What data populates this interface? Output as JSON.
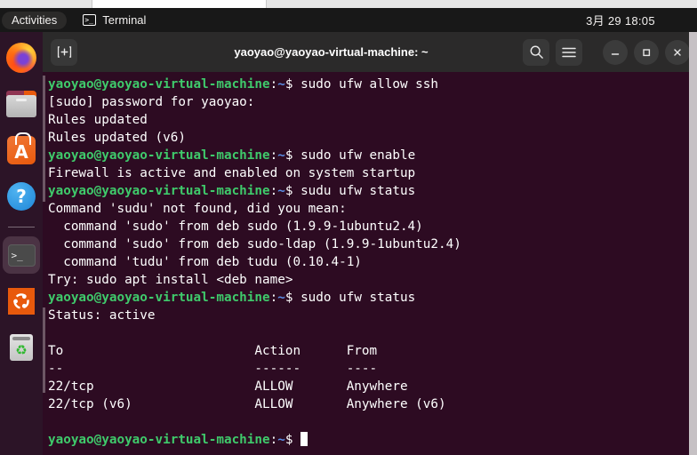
{
  "topbar": {
    "activities": "Activities",
    "app_name": "Terminal",
    "app_icon": "terminal-icon",
    "terminal_glyph": ">_",
    "clock": "3月 29  18:05"
  },
  "dock": {
    "items": [
      {
        "name": "firefox",
        "label": "Firefox",
        "running": false
      },
      {
        "name": "files",
        "label": "Files",
        "running": false
      },
      {
        "name": "app-center",
        "label": "App Center",
        "letter": "A",
        "running": false
      },
      {
        "name": "help",
        "label": "Help",
        "glyph": "?",
        "running": false
      },
      {
        "name": "terminal",
        "label": "Terminal",
        "glyph": ">_",
        "running": true
      },
      {
        "name": "ubuntu-software",
        "label": "Ubuntu Software",
        "running": false
      },
      {
        "name": "trash",
        "label": "Trash",
        "glyph": "♻",
        "running": false
      }
    ]
  },
  "window": {
    "title": "yaoyao@yaoyao-virtual-machine: ~",
    "new_tab_label": "+",
    "search_label": "Search",
    "menu_label": "Menu",
    "minimize_label": "—",
    "maximize_label": "□",
    "close_label": "✕",
    "colors": {
      "terminal_bg": "#2d0b22",
      "header_bg": "#2b2a2a",
      "prompt_user": "#3fca6b",
      "prompt_path": "#5b8fe8",
      "text": "#ffffff",
      "dock_bg": "#2c1427",
      "accent_orange": "#e8590c"
    }
  },
  "terminal": {
    "prompt": {
      "user_host": "yaoyao@yaoyao-virtual-machine",
      "separator": ":",
      "path": "~",
      "dollar": "$ "
    },
    "lines": [
      {
        "type": "prompt",
        "command": "sudo ufw allow ssh"
      },
      {
        "type": "output",
        "text": "[sudo] password for yaoyao:"
      },
      {
        "type": "output",
        "text": "Rules updated"
      },
      {
        "type": "output",
        "text": "Rules updated (v6)"
      },
      {
        "type": "prompt",
        "command": "sudo ufw enable"
      },
      {
        "type": "output",
        "text": "Firewall is active and enabled on system startup"
      },
      {
        "type": "prompt",
        "command": "sudu ufw status"
      },
      {
        "type": "output",
        "text": "Command 'sudu' not found, did you mean:"
      },
      {
        "type": "output",
        "text": "  command 'sudo' from deb sudo (1.9.9-1ubuntu2.4)"
      },
      {
        "type": "output",
        "text": "  command 'sudo' from deb sudo-ldap (1.9.9-1ubuntu2.4)"
      },
      {
        "type": "output",
        "text": "  command 'tudu' from deb tudu (0.10.4-1)"
      },
      {
        "type": "output",
        "text": "Try: sudo apt install <deb name>"
      },
      {
        "type": "prompt",
        "command": "sudo ufw status"
      },
      {
        "type": "output",
        "text": "Status: active"
      },
      {
        "type": "output",
        "text": ""
      },
      {
        "type": "output",
        "text": "To                         Action      From"
      },
      {
        "type": "output",
        "text": "--                         ------      ----"
      },
      {
        "type": "output",
        "text": "22/tcp                     ALLOW       Anywhere"
      },
      {
        "type": "output",
        "text": "22/tcp (v6)                ALLOW       Anywhere (v6)"
      },
      {
        "type": "output",
        "text": ""
      },
      {
        "type": "prompt",
        "command": "",
        "cursor": true
      }
    ],
    "ufw_table": {
      "headers": [
        "To",
        "Action",
        "From"
      ],
      "rows": [
        [
          "22/tcp",
          "ALLOW",
          "Anywhere"
        ],
        [
          "22/tcp (v6)",
          "ALLOW",
          "Anywhere (v6)"
        ]
      ],
      "status": "Status: active"
    }
  }
}
